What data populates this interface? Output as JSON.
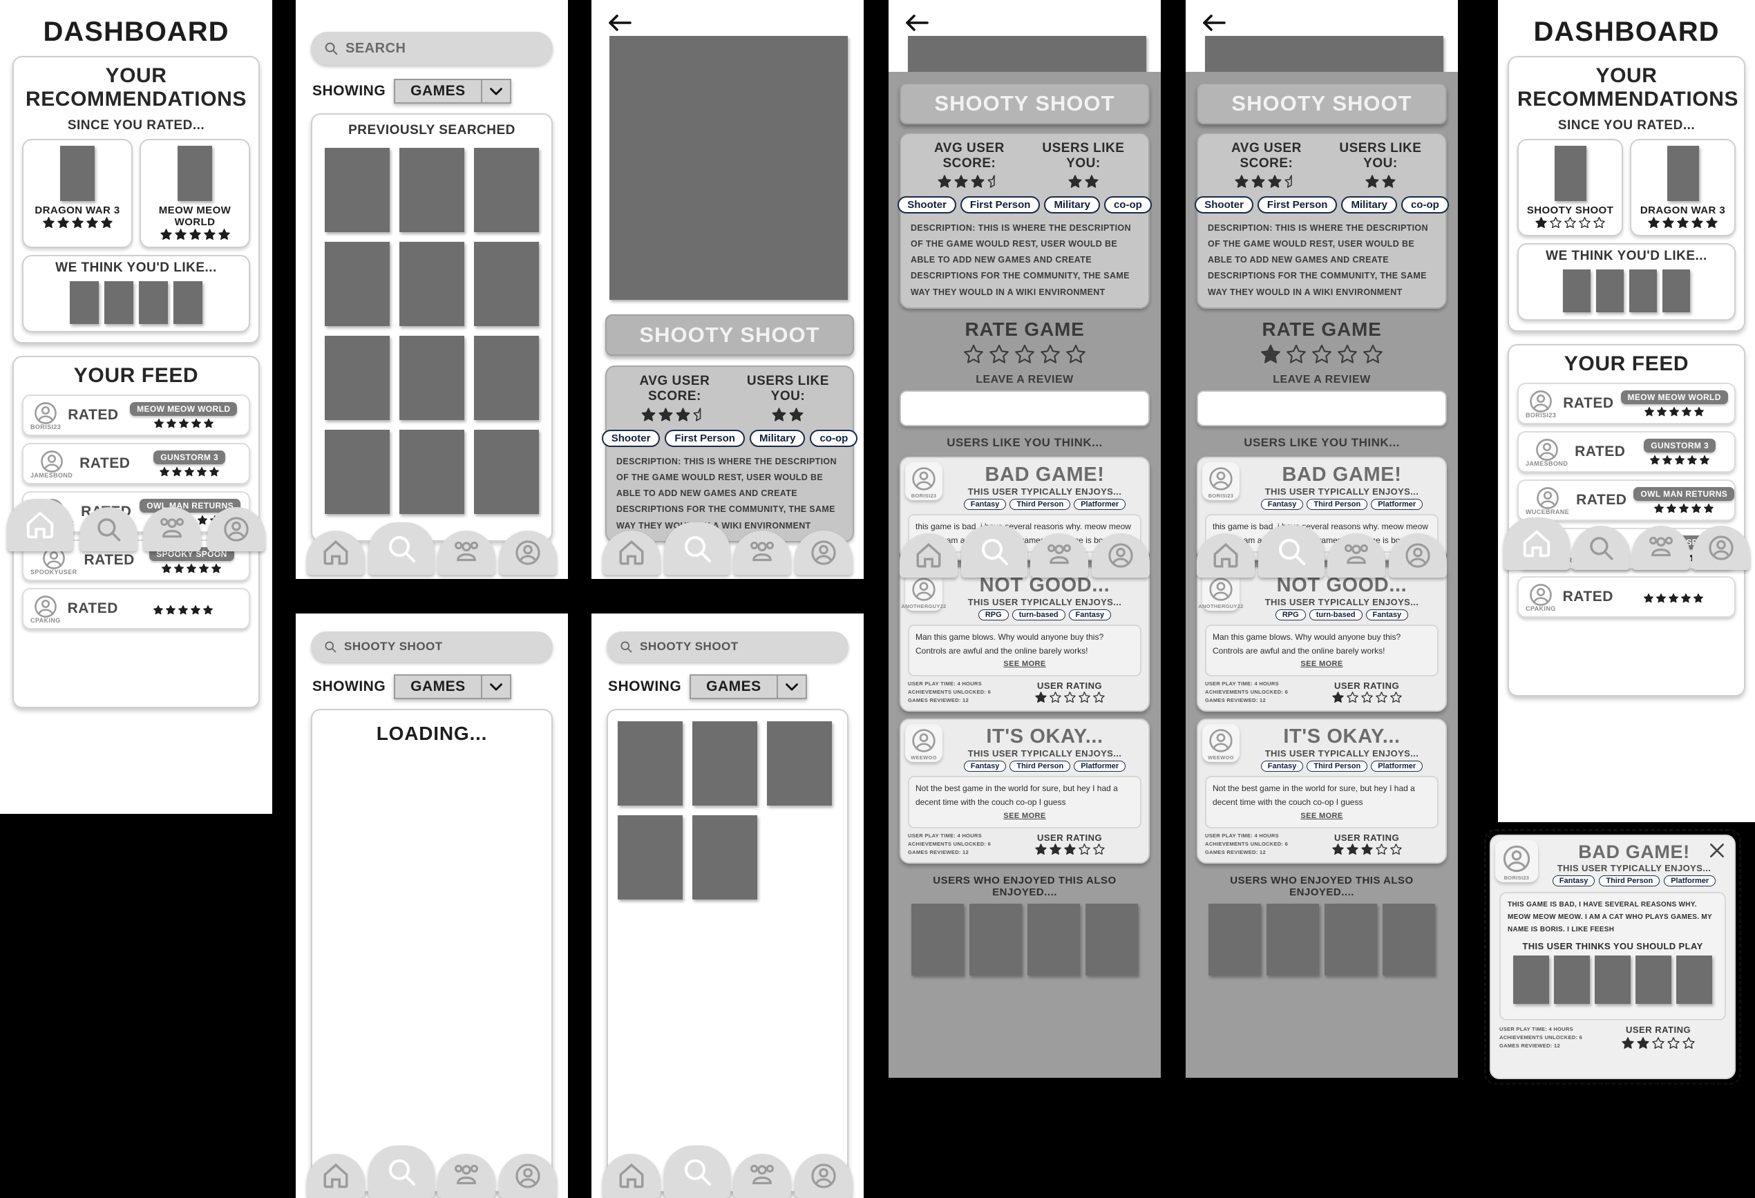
{
  "colors": {
    "thumb": "#6e6e6e",
    "panel_gray": "#9d9d9d",
    "chip": "#7a7a7a",
    "accent_dark": "#1d1d1d"
  },
  "nav": {
    "items": [
      {
        "name": "home",
        "label": "Home"
      },
      {
        "name": "search",
        "label": "Search"
      },
      {
        "name": "community",
        "label": "Community"
      },
      {
        "name": "profile",
        "label": "Profile"
      }
    ]
  },
  "dashboard": {
    "title": "DASHBOARD",
    "recommendations_title": "YOUR RECOMMENDATIONS",
    "since_you_rated": "SINCE YOU RATED...",
    "we_think_title": "WE THINK YOU'D LIKE...",
    "feed_title": "YOUR FEED",
    "rated_games_left": [
      {
        "name": "DRAGON WAR 3",
        "stars": 5
      },
      {
        "name": "MEOW MEOW WORLD",
        "stars": 5
      }
    ],
    "rated_games_right": [
      {
        "name": "SHOOTY SHOOT",
        "stars": 1
      },
      {
        "name": "DRAGON WAR 3",
        "stars": 5
      }
    ],
    "suggestion_count": 4,
    "feed": [
      {
        "user": "BORISI23",
        "action": "RATED",
        "game": "MEOW MEOW WORLD",
        "stars": 5
      },
      {
        "user": "JAMESBOND",
        "action": "RATED",
        "game": "GUNSTORM 3",
        "stars": 5
      },
      {
        "user": "WUCEBRANE",
        "action": "RATED",
        "game": "OWL MAN RETURNS",
        "stars": 5
      },
      {
        "user": "SPOOKYUSER",
        "action": "RATED",
        "game": "SPOOKY SPOON",
        "stars": 5
      },
      {
        "user": "CPAKING",
        "action": "RATED",
        "game": "",
        "stars": 5
      }
    ]
  },
  "search_empty": {
    "placeholder": "SEARCH",
    "showing_label": "SHOWING",
    "filter_value": "GAMES",
    "section_title": "PREVIOUSLY SEARCHED",
    "result_count": 12
  },
  "search_loading": {
    "query": "SHOOTY SHOOT",
    "showing_label": "SHOWING",
    "filter_value": "GAMES",
    "loading_text": "LOADING..."
  },
  "search_results": {
    "query": "SHOOTY SHOOT",
    "showing_label": "SHOWING",
    "filter_value": "GAMES",
    "result_count": 5
  },
  "game": {
    "title": "SHOOTY SHOOT",
    "avg_score_label": "AVG USER SCORE:",
    "avg_score_stars": 3.5,
    "users_like_you_label": "USERS LIKE YOU:",
    "users_like_you_stars": 2,
    "tags": [
      "Shooter",
      "First Person",
      "Military",
      "co-op"
    ],
    "description": "DESCRIPTION: THIS IS WHERE THE DESCRIPTION OF THE GAME WOULD REST, USER WOULD BE ABLE TO ADD NEW GAMES AND CREATE DESCRIPTIONS FOR THE COMMUNITY, THE SAME WAY THEY WOULD IN A WIKI ENVIRONMENT",
    "rate_game_label": "RATE GAME",
    "rate_game_stars_unselected": 0,
    "rate_game_stars_selected": 1,
    "leave_review_label": "LEAVE A REVIEW",
    "users_like_you_think": "USERS LIKE YOU THINK...",
    "also_enjoyed_label": "USERS WHO ENJOYED THIS ALSO ENJOYED....",
    "also_enjoyed_count": 4
  },
  "reviews": [
    {
      "user": "BORISI23",
      "title": "BAD GAME!",
      "subtitle": "THIS USER TYPICALLY ENJOYS...",
      "tags": [
        "Fantasy",
        "Third Person",
        "Platformer"
      ],
      "body": "this game is bad, i have several reasons why. meow meow meow. I am a cat who plays games. My name is boris. I like",
      "see_more": "SEE MORE",
      "play_time": "USER PLAY TIME: 4 HOURS",
      "achievements": "ACHIEVEMENTS UNLOCKED: 6",
      "games_reviewed": "GAMES REVIEWED: 12",
      "rating_label": "USER RATING",
      "stars": 2
    },
    {
      "user": "ANOTHERGUY22",
      "title": "NOT GOOD...",
      "subtitle": "THIS USER TYPICALLY ENJOYS...",
      "tags": [
        "RPG",
        "turn-based",
        "Fantasy"
      ],
      "body": "Man this game blows. Why would anyone buy this? Controls are awful and the online barely works!",
      "see_more": "SEE MORE",
      "play_time": "USER PLAY TIME: 4 HOURS",
      "achievements": "ACHIEVEMENTS UNLOCKED: 6",
      "games_reviewed": "GAMES REVIEWED: 12",
      "rating_label": "USER RATING",
      "stars": 1
    },
    {
      "user": "WEEWOO",
      "title": "IT'S OKAY...",
      "subtitle": "THIS USER TYPICALLY ENJOYS...",
      "tags": [
        "Fantasy",
        "Third Person",
        "Platformer"
      ],
      "body": "Not the best game in the world for sure, but hey I had a decent time with  the couch co-op I guess",
      "see_more": "SEE MORE",
      "play_time": "USER PLAY TIME: 4 HOURS",
      "achievements": "ACHIEVEMENTS UNLOCKED: 6",
      "games_reviewed": "GAMES REVIEWED: 12",
      "rating_label": "USER RATING",
      "stars": 3
    }
  ],
  "modal": {
    "user": "BORISI23",
    "title": "BAD GAME!",
    "subtitle": "THIS USER TYPICALLY ENJOYS...",
    "tags": [
      "Fantasy",
      "Third Person",
      "Platformer"
    ],
    "body": "THIS GAME IS BAD, I HAVE SEVERAL REASONS WHY. MEOW MEOW MEOW. I AM A CAT WHO PLAYS GAMES. MY NAME IS BORIS. I LIKE FEESH",
    "should_play_label": "THIS USER THINKS YOU SHOULD PLAY",
    "should_play_count": 5,
    "play_time": "USER PLAY TIME: 4 HOURS",
    "achievements": "ACHIEVEMENTS UNLOCKED: 6",
    "games_reviewed": "GAMES REVIEWED: 12",
    "rating_label": "USER RATING",
    "stars": 2,
    "close_label": "×"
  }
}
